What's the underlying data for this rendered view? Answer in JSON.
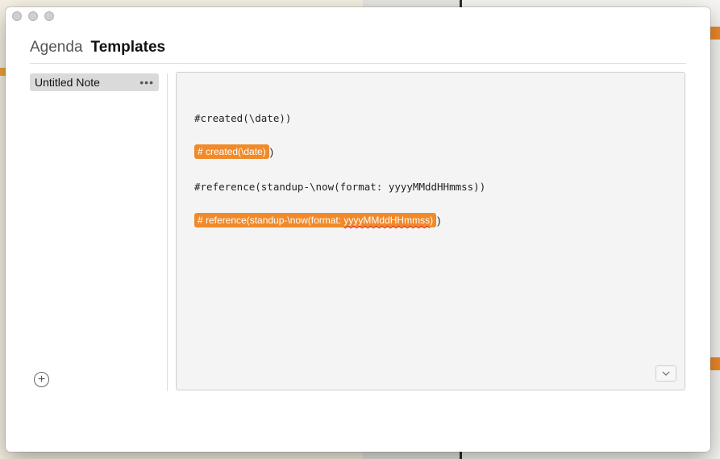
{
  "window": {
    "tabs": [
      {
        "label": "Agenda",
        "active": false
      },
      {
        "label": "Templates",
        "active": true
      }
    ]
  },
  "sidebar": {
    "items": [
      {
        "label": "Untitled Note",
        "more": "•••"
      }
    ],
    "add_icon": "plus-circle-icon"
  },
  "editor": {
    "line1": "#created(\\date))",
    "token2_text": "# created(\\date)",
    "token2_after": ")",
    "line3": "#reference(standup-\\now(format: yyyyMMddHHmmss))",
    "token4_prefix": "# reference(standup-\\now(format: ",
    "token4_squiggle": "yyyyMMddHHmmss",
    "token4_suffix": ")",
    "token4_after": ")",
    "chevron_icon": "chevron-down-icon"
  },
  "colors": {
    "accent": "#f08a2a",
    "selection": "#dadada",
    "editor_bg": "#f4f4f4"
  }
}
